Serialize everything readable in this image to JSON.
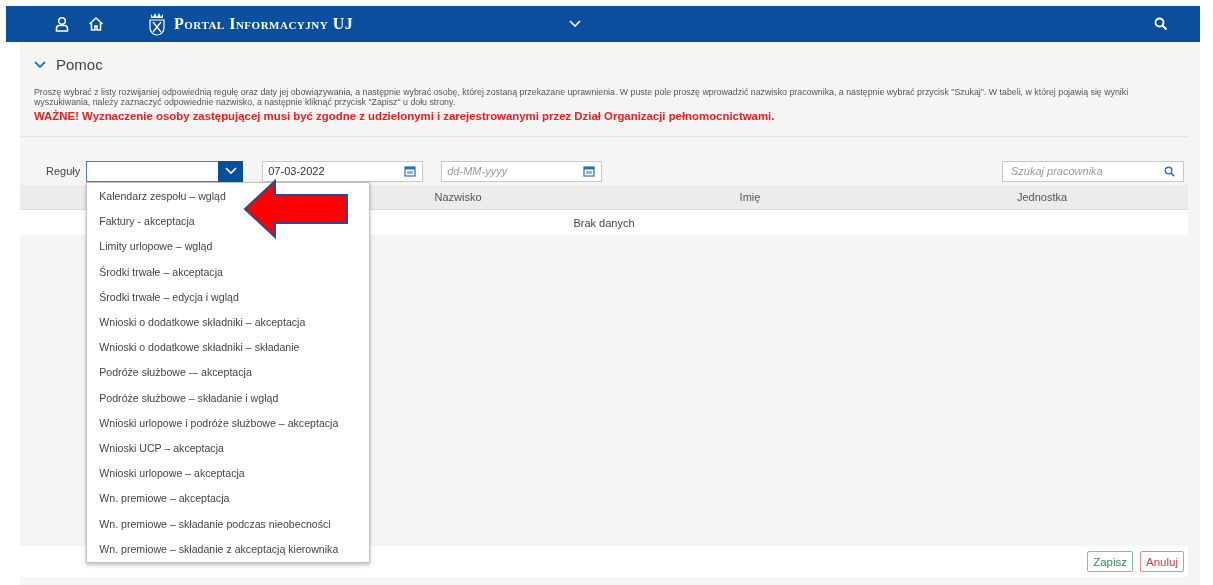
{
  "header": {
    "title": "Portal Informacyjny UJ"
  },
  "help": {
    "title": "Pomoc",
    "expanded": true,
    "text": "Proszę wybrać z listy rozwijaniej odpowiednią regułę oraz daty jej obowiązywania, a następnie wybrać osobę, której zostaną przekazane uprawnienia. W puste pole proszę wprowadzić nazwisko pracownika, a następnie wybrać przycisk \"Szukaj\". W tabeli, w której pojawią się wyniki wyszukiwania, należy zaznaczyć odpowiednie nazwisko, a następnie kliknąć przycisk \"Zapisz\" u dołu strony.",
    "warning": "WAŻNE! Wyznaczenie osoby zastępującej musi być zgodne z udzielonymi i zarejestrowanymi przez Dział Organizacji pełnomocnictwami."
  },
  "filters": {
    "rules_label": "Reguły",
    "date_from": "07-03-2022",
    "date_to_placeholder": "dd-MM-yyyy",
    "search_placeholder": "Szukaj pracownika"
  },
  "dropdown": {
    "expanded": true,
    "options": [
      {
        "label": "Kalendarz zespołu – wgląd"
      },
      {
        "label": "Faktury - akceptacja"
      },
      {
        "label": "Limity urlopowe – wgląd"
      },
      {
        "label": "Środki trwałe – akceptacja"
      },
      {
        "label": "Środki trwałe – edycja i wgląd"
      },
      {
        "label": "Wnioski o dodatkowe składniki – akceptacja"
      },
      {
        "label": "Wnioski o dodatkowe składniki – składanie"
      },
      {
        "label": "Podróże służbowe -– akceptacja"
      },
      {
        "label": "Podróże służbowe – składanie i wgląd"
      },
      {
        "label": "Wnioski urlopowe i podróże służbowe – akceptacja"
      },
      {
        "label": "Wnioski UCP – akceptacja"
      },
      {
        "label": "Wnioski urlopowe – akceptacja"
      },
      {
        "label": "Wn. premiowe – akceptacja"
      },
      {
        "label": "Wn. premiowe – składanie podczas nieobecności"
      },
      {
        "label": "Wn. premiowe – składanie z akceptacją kierownika"
      }
    ]
  },
  "table": {
    "columns": [
      "Nazwisko",
      "Imię",
      "Jednostka"
    ],
    "empty_text": "Brak danych"
  },
  "buttons": [
    {
      "label": "Zapisz",
      "kind": "save"
    },
    {
      "label": "Anuluj",
      "kind": "cancel"
    }
  ]
}
